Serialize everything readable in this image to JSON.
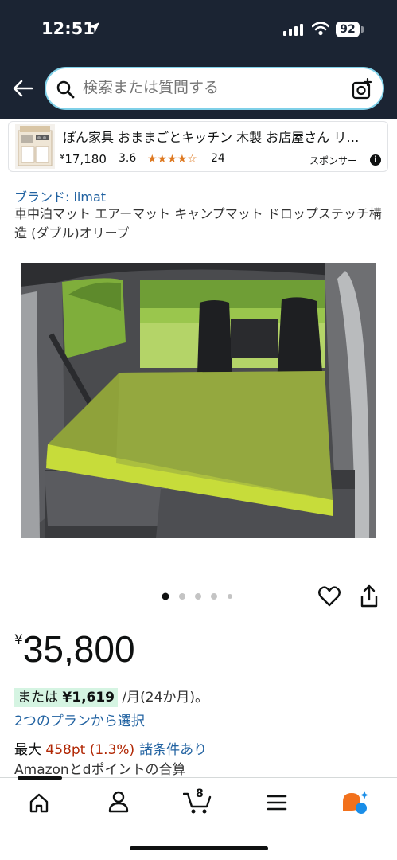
{
  "status_bar": {
    "time": "12:51",
    "battery": "92"
  },
  "search": {
    "placeholder": "検索または質問する"
  },
  "sponsored": {
    "title": "ぽん家具 おままごとキッチン 木製 お店屋さん リ…",
    "price_symbol": "¥",
    "price": "17,180",
    "rating": "3.6",
    "stars": "★★★★☆",
    "review_count": "24",
    "label": "スポンサー",
    "info_icon": "i"
  },
  "product": {
    "brand": "ブランド: iimat",
    "title": "車中泊マット エアーマット キャンプマット ドロップステッチ構造 (ダブル)オリーブ"
  },
  "gallery": {
    "image_count": 5,
    "active_index": 0
  },
  "price": {
    "symbol": "¥",
    "amount": "35,800",
    "installment_prefix": "または",
    "installment_amount": "¥1,619",
    "installment_suffix": "/月(24か月)。",
    "plans_link": "2つのプランから選択",
    "points_prefix": "最大",
    "points_value": "458pt (1.3%)",
    "points_link": "諸条件あり",
    "points_note": "Amazonとdポイントの合算"
  },
  "bottom_nav": {
    "cart_count": "8"
  },
  "colors": {
    "header_bg": "#1b2433",
    "link": "#2162a1",
    "price_red": "#b12704",
    "star": "#de7921",
    "install_highlight": "#d5f4e2",
    "mat_green": "#8fa23a"
  },
  "icons": [
    "location-arrow-icon",
    "signal-icon",
    "wifi-icon",
    "back-arrow-icon",
    "search-icon",
    "camera-icon",
    "info-icon",
    "heart-icon",
    "share-icon",
    "home-icon",
    "account-icon",
    "cart-icon",
    "menu-icon",
    "rufus-icon"
  ]
}
